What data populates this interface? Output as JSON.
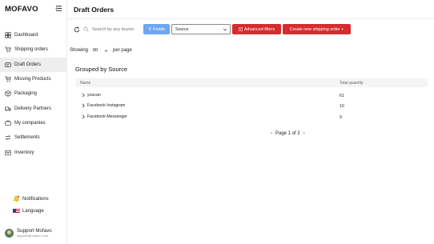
{
  "app": {
    "logo": "MOFAVO"
  },
  "page": {
    "title": "Draft Orders"
  },
  "sidebar": {
    "items": [
      {
        "label": "Dashboard",
        "icon": "dashboard-icon"
      },
      {
        "label": "Shipping orders",
        "icon": "cart-icon"
      },
      {
        "label": "Draft Orders",
        "icon": "draft-icon",
        "active": true
      },
      {
        "label": "Missing Products",
        "icon": "cart-missing-icon"
      },
      {
        "label": "Packaging",
        "icon": "box-icon"
      },
      {
        "label": "Delivery Partners",
        "icon": "truck-icon"
      },
      {
        "label": "My companies",
        "icon": "companies-icon"
      },
      {
        "label": "Settlements",
        "icon": "settlements-icon"
      },
      {
        "label": "Inventory",
        "icon": "inventory-icon"
      }
    ],
    "notifications": "Notifications",
    "language": "Language",
    "support": {
      "name": "Support Mofavo",
      "email": "support@mofavo.com"
    }
  },
  "toolbar": {
    "search_placeholder": "Search by any keywo",
    "fields_label": "Fields",
    "source_select": "Source",
    "advanced_label": "Advanced filters",
    "create_label": "Create new shipping order +"
  },
  "pagination": {
    "showing_label": "Showing",
    "per_page_value": "80",
    "per_page_label": "per page",
    "page_text": "Page 1 of 2"
  },
  "group": {
    "title": "Grouped by Source",
    "columns": {
      "name": "Name",
      "total": "Total quantity"
    },
    "rows": [
      {
        "name": "youcan",
        "total": "61"
      },
      {
        "name": "Facebook Instagram",
        "total": "10"
      },
      {
        "name": "Facebook Messenger",
        "total": "9"
      }
    ]
  },
  "colors": {
    "primary_red": "#d62b2f",
    "fields_blue": "#6ea6f1"
  }
}
